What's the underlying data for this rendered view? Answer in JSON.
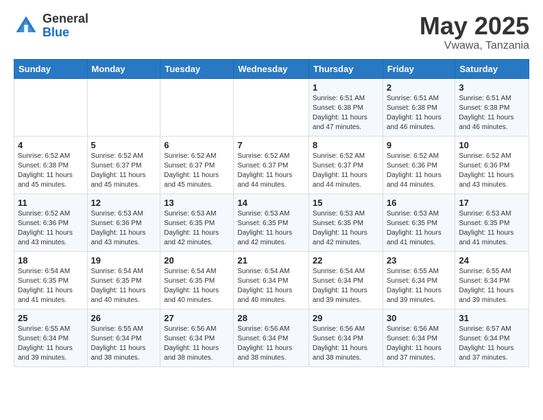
{
  "header": {
    "logo_general": "General",
    "logo_blue": "Blue",
    "title": "May 2025",
    "location": "Vwawa, Tanzania"
  },
  "days_of_week": [
    "Sunday",
    "Monday",
    "Tuesday",
    "Wednesday",
    "Thursday",
    "Friday",
    "Saturday"
  ],
  "weeks": [
    [
      {
        "day": "",
        "info": ""
      },
      {
        "day": "",
        "info": ""
      },
      {
        "day": "",
        "info": ""
      },
      {
        "day": "",
        "info": ""
      },
      {
        "day": "1",
        "info": "Sunrise: 6:51 AM\nSunset: 6:38 PM\nDaylight: 11 hours and 47 minutes."
      },
      {
        "day": "2",
        "info": "Sunrise: 6:51 AM\nSunset: 6:38 PM\nDaylight: 11 hours and 46 minutes."
      },
      {
        "day": "3",
        "info": "Sunrise: 6:51 AM\nSunset: 6:38 PM\nDaylight: 11 hours and 46 minutes."
      }
    ],
    [
      {
        "day": "4",
        "info": "Sunrise: 6:52 AM\nSunset: 6:38 PM\nDaylight: 11 hours and 45 minutes."
      },
      {
        "day": "5",
        "info": "Sunrise: 6:52 AM\nSunset: 6:37 PM\nDaylight: 11 hours and 45 minutes."
      },
      {
        "day": "6",
        "info": "Sunrise: 6:52 AM\nSunset: 6:37 PM\nDaylight: 11 hours and 45 minutes."
      },
      {
        "day": "7",
        "info": "Sunrise: 6:52 AM\nSunset: 6:37 PM\nDaylight: 11 hours and 44 minutes."
      },
      {
        "day": "8",
        "info": "Sunrise: 6:52 AM\nSunset: 6:37 PM\nDaylight: 11 hours and 44 minutes."
      },
      {
        "day": "9",
        "info": "Sunrise: 6:52 AM\nSunset: 6:36 PM\nDaylight: 11 hours and 44 minutes."
      },
      {
        "day": "10",
        "info": "Sunrise: 6:52 AM\nSunset: 6:36 PM\nDaylight: 11 hours and 43 minutes."
      }
    ],
    [
      {
        "day": "11",
        "info": "Sunrise: 6:52 AM\nSunset: 6:36 PM\nDaylight: 11 hours and 43 minutes."
      },
      {
        "day": "12",
        "info": "Sunrise: 6:53 AM\nSunset: 6:36 PM\nDaylight: 11 hours and 43 minutes."
      },
      {
        "day": "13",
        "info": "Sunrise: 6:53 AM\nSunset: 6:35 PM\nDaylight: 11 hours and 42 minutes."
      },
      {
        "day": "14",
        "info": "Sunrise: 6:53 AM\nSunset: 6:35 PM\nDaylight: 11 hours and 42 minutes."
      },
      {
        "day": "15",
        "info": "Sunrise: 6:53 AM\nSunset: 6:35 PM\nDaylight: 11 hours and 42 minutes."
      },
      {
        "day": "16",
        "info": "Sunrise: 6:53 AM\nSunset: 6:35 PM\nDaylight: 11 hours and 41 minutes."
      },
      {
        "day": "17",
        "info": "Sunrise: 6:53 AM\nSunset: 6:35 PM\nDaylight: 11 hours and 41 minutes."
      }
    ],
    [
      {
        "day": "18",
        "info": "Sunrise: 6:54 AM\nSunset: 6:35 PM\nDaylight: 11 hours and 41 minutes."
      },
      {
        "day": "19",
        "info": "Sunrise: 6:54 AM\nSunset: 6:35 PM\nDaylight: 11 hours and 40 minutes."
      },
      {
        "day": "20",
        "info": "Sunrise: 6:54 AM\nSunset: 6:35 PM\nDaylight: 11 hours and 40 minutes."
      },
      {
        "day": "21",
        "info": "Sunrise: 6:54 AM\nSunset: 6:34 PM\nDaylight: 11 hours and 40 minutes."
      },
      {
        "day": "22",
        "info": "Sunrise: 6:54 AM\nSunset: 6:34 PM\nDaylight: 11 hours and 39 minutes."
      },
      {
        "day": "23",
        "info": "Sunrise: 6:55 AM\nSunset: 6:34 PM\nDaylight: 11 hours and 39 minutes."
      },
      {
        "day": "24",
        "info": "Sunrise: 6:55 AM\nSunset: 6:34 PM\nDaylight: 11 hours and 39 minutes."
      }
    ],
    [
      {
        "day": "25",
        "info": "Sunrise: 6:55 AM\nSunset: 6:34 PM\nDaylight: 11 hours and 39 minutes."
      },
      {
        "day": "26",
        "info": "Sunrise: 6:55 AM\nSunset: 6:34 PM\nDaylight: 11 hours and 38 minutes."
      },
      {
        "day": "27",
        "info": "Sunrise: 6:56 AM\nSunset: 6:34 PM\nDaylight: 11 hours and 38 minutes."
      },
      {
        "day": "28",
        "info": "Sunrise: 6:56 AM\nSunset: 6:34 PM\nDaylight: 11 hours and 38 minutes."
      },
      {
        "day": "29",
        "info": "Sunrise: 6:56 AM\nSunset: 6:34 PM\nDaylight: 11 hours and 38 minutes."
      },
      {
        "day": "30",
        "info": "Sunrise: 6:56 AM\nSunset: 6:34 PM\nDaylight: 11 hours and 37 minutes."
      },
      {
        "day": "31",
        "info": "Sunrise: 6:57 AM\nSunset: 6:34 PM\nDaylight: 11 hours and 37 minutes."
      }
    ]
  ]
}
